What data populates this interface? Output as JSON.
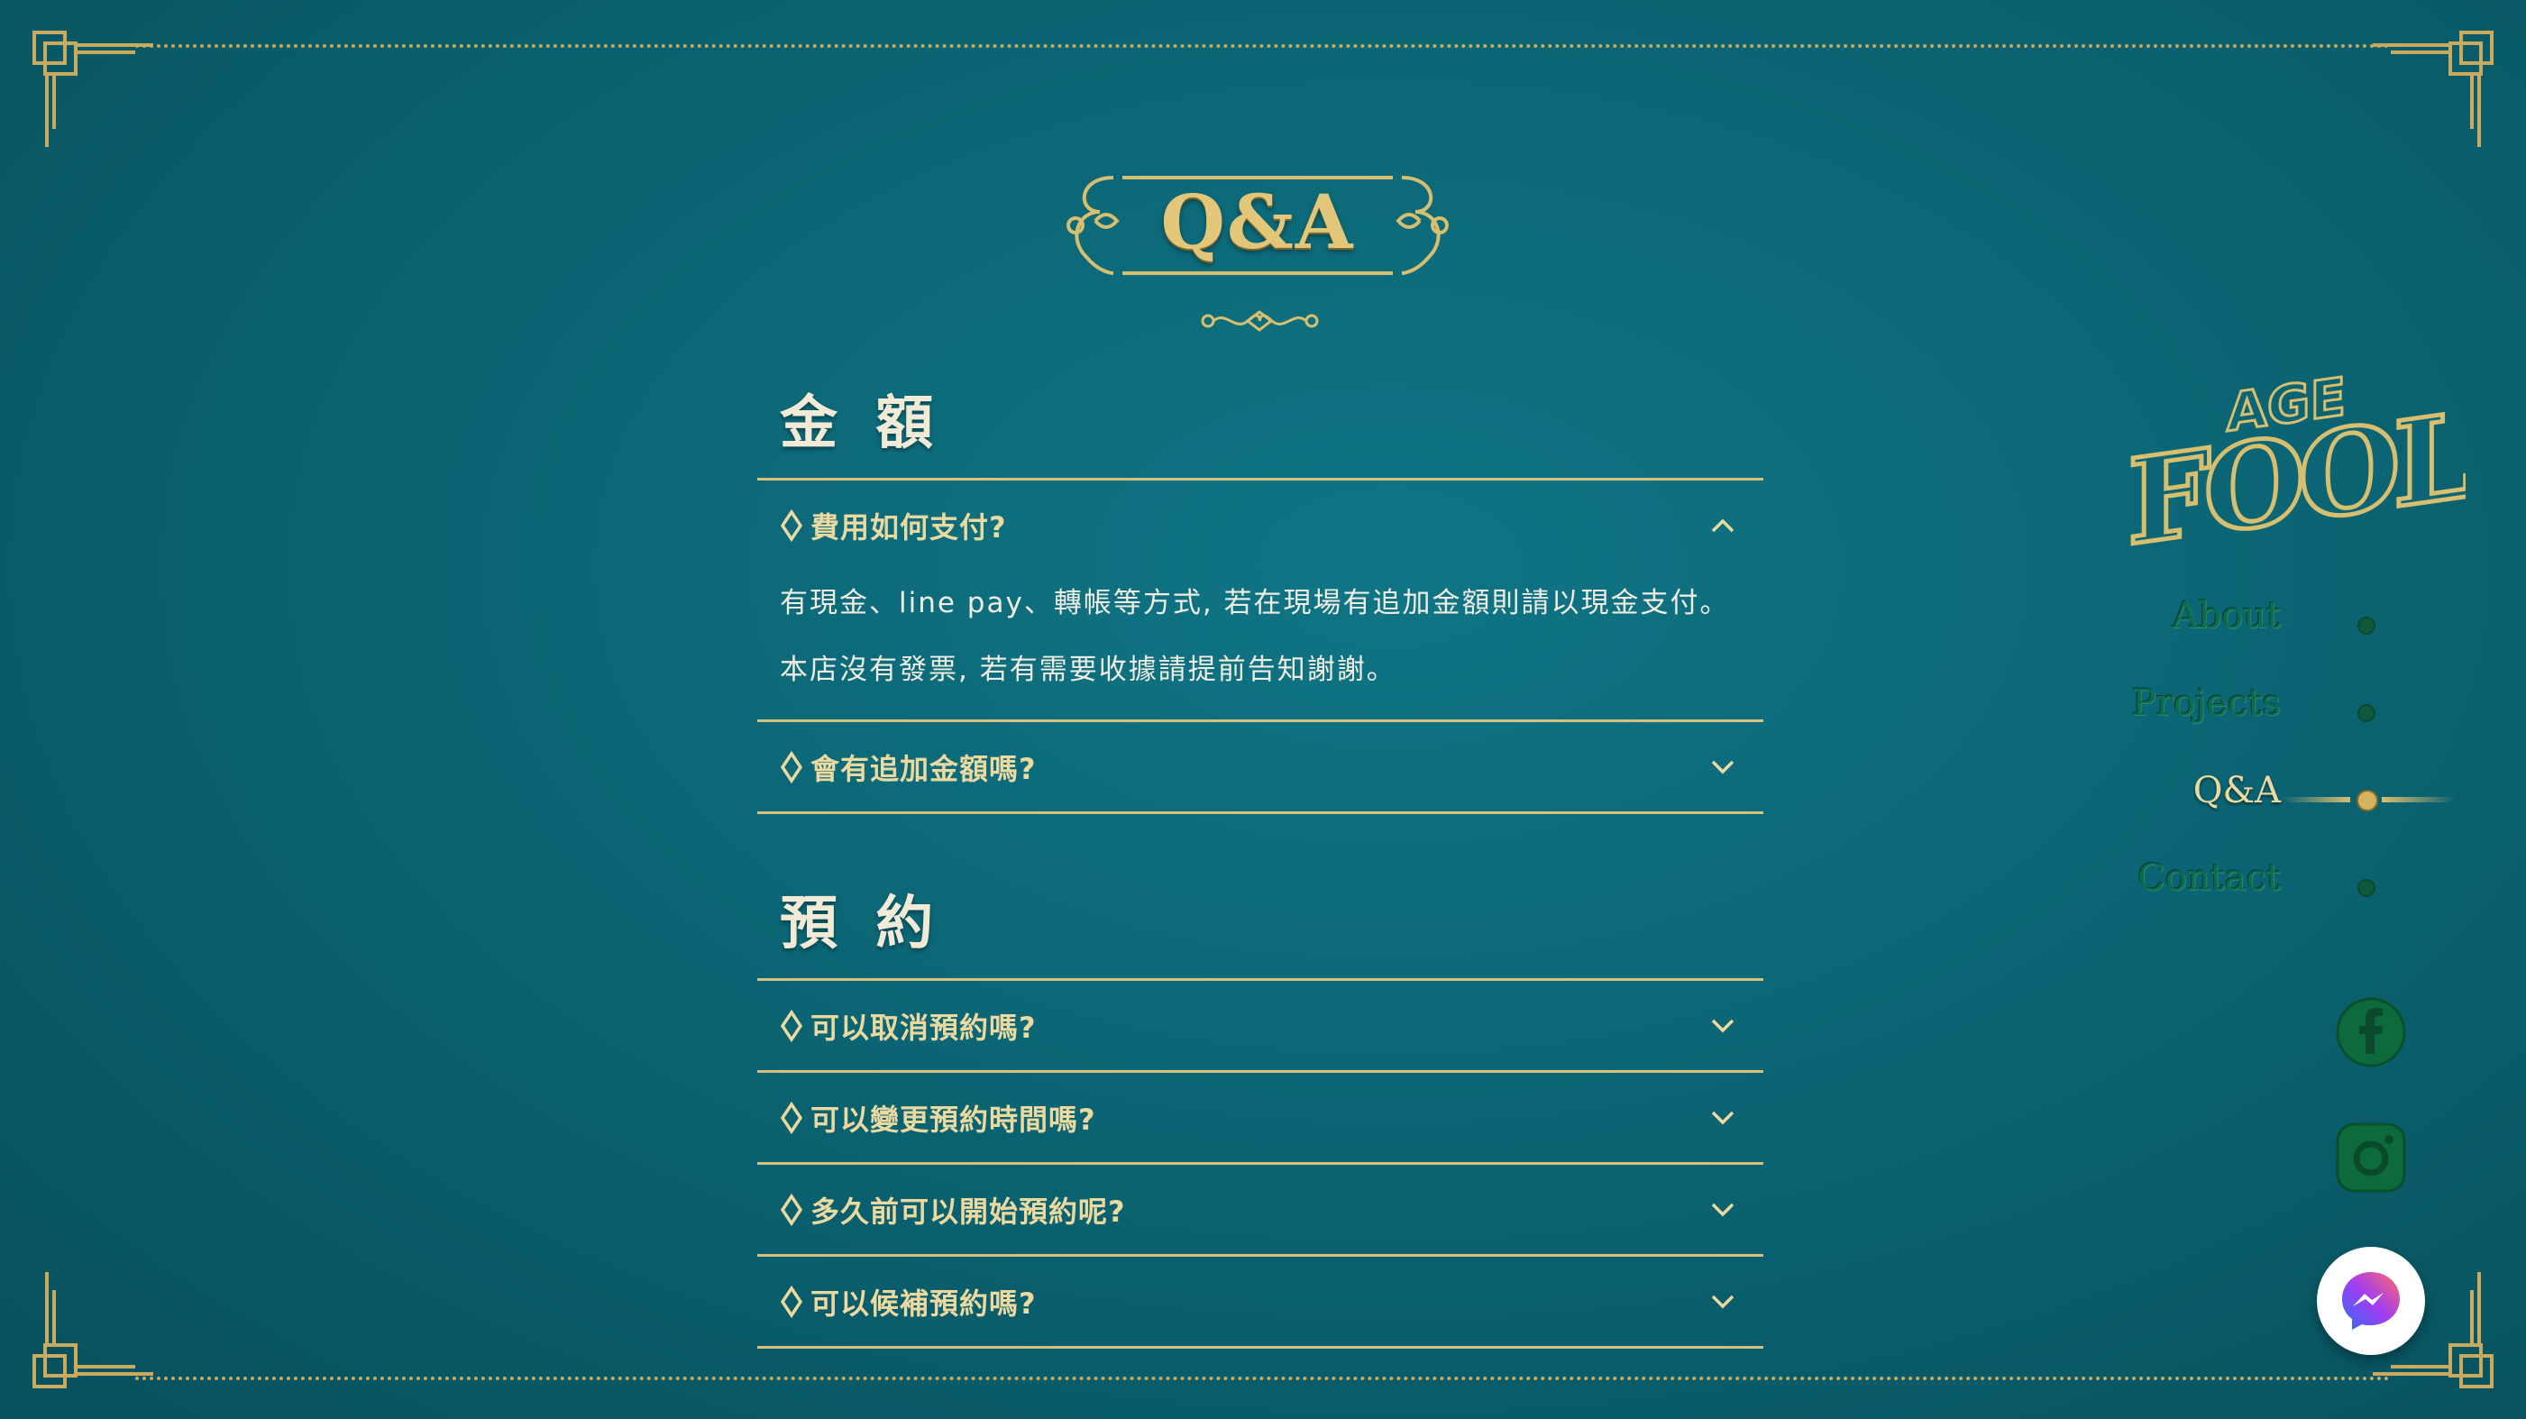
{
  "page": {
    "title": "Q&A",
    "colors": {
      "background": "#0b6574",
      "gold": "#d6c17e",
      "text": "#f0ede3",
      "nav_inactive": "#0d6a4e"
    }
  },
  "sections": [
    {
      "title": "金 額",
      "items": [
        {
          "question": "費用如何支付?",
          "expanded": true,
          "answer": [
            "有現金、line pay、轉帳等方式, 若在現場有追加金額則請以現金支付。",
            "本店沒有發票, 若有需要收據請提前告知謝謝。"
          ]
        },
        {
          "question": "會有追加金額嗎?",
          "expanded": false
        }
      ]
    },
    {
      "title": "預 約",
      "items": [
        {
          "question": "可以取消預約嗎?",
          "expanded": false
        },
        {
          "question": "可以變更預約時間嗎?",
          "expanded": false
        },
        {
          "question": "多久前可以開始預約呢?",
          "expanded": false
        },
        {
          "question": "可以候補預約嗎?",
          "expanded": false
        }
      ]
    }
  ],
  "logo": {
    "top_text": "AGE",
    "main_text": "FOOL"
  },
  "nav": [
    {
      "label": "About",
      "active": false
    },
    {
      "label": "Projects",
      "active": false
    },
    {
      "label": "Q&A",
      "active": true
    },
    {
      "label": "Contact",
      "active": false
    }
  ],
  "social": {
    "facebook_icon": "facebook-icon",
    "instagram_icon": "instagram-icon",
    "messenger_icon": "messenger-icon"
  }
}
